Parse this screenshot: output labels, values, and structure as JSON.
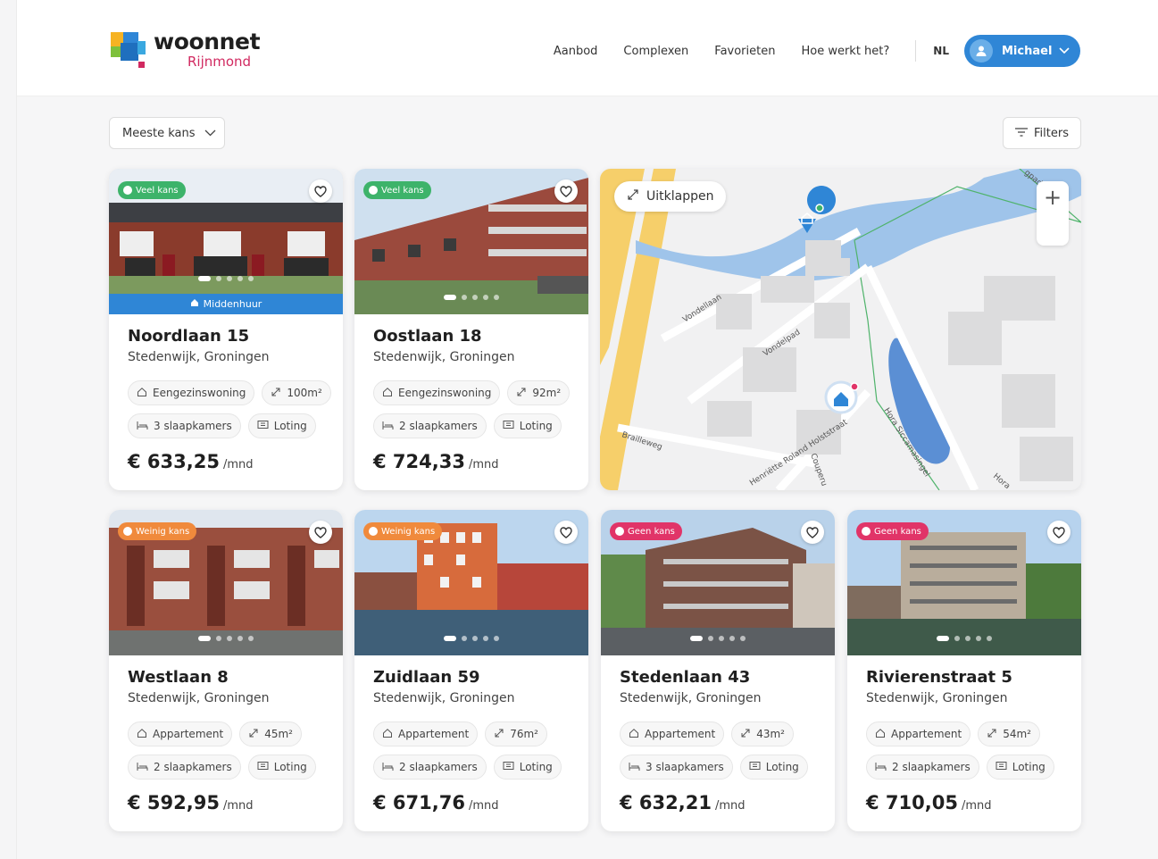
{
  "brand": {
    "name": "woonnet",
    "region": "Rijnmond"
  },
  "nav": {
    "items": [
      "Aanbod",
      "Complexen",
      "Favorieten",
      "Hoe werkt het?"
    ],
    "language": "NL",
    "user": "Michael"
  },
  "toolbar": {
    "sort_label": "Meeste kans",
    "filters_label": "Filters"
  },
  "map": {
    "expand_label": "Uitklappen",
    "streets": [
      "Vondellaan",
      "Vondelpad",
      "Brailleweg",
      "Hora Siccamasingel",
      "Henriëtte Roland Holststraat",
      "Couperu",
      "Hora",
      "gpad"
    ]
  },
  "colors": {
    "primary": "#2f86d6",
    "veel": "#3db36a",
    "weinig": "#f08a3c",
    "geen": "#e13468",
    "brand_pink": "#d12960"
  },
  "listings": [
    {
      "title": "Noordlaan 15",
      "location": "Stedenwijk, Groningen",
      "chance": "Veel kans",
      "chance_type": "veel",
      "ribbon": "Middenhuur",
      "type": "Eengezinswoning",
      "area": "100m²",
      "rooms": "3 slaapkamers",
      "method": "Loting",
      "price": "€ 633,25",
      "unit": "/mnd"
    },
    {
      "title": "Oostlaan 18",
      "location": "Stedenwijk, Groningen",
      "chance": "Veel kans",
      "chance_type": "veel",
      "type": "Eengezinswoning",
      "area": "92m²",
      "rooms": "2 slaapkamers",
      "method": "Loting",
      "price": "€ 724,33",
      "unit": "/mnd"
    },
    {
      "title": "Westlaan 8",
      "location": "Stedenwijk, Groningen",
      "chance": "Weinig kans",
      "chance_type": "weinig",
      "type": "Appartement",
      "area": "45m²",
      "rooms": "2 slaapkamers",
      "method": "Loting",
      "price": "€ 592,95",
      "unit": "/mnd"
    },
    {
      "title": "Zuidlaan 59",
      "location": "Stedenwijk, Groningen",
      "chance": "Weinig kans",
      "chance_type": "weinig",
      "type": "Appartement",
      "area": "76m²",
      "rooms": "2 slaapkamers",
      "method": "Loting",
      "price": "€ 671,76",
      "unit": "/mnd"
    },
    {
      "title": "Stedenlaan 43",
      "location": "Stedenwijk, Groningen",
      "chance": "Geen kans",
      "chance_type": "geen",
      "type": "Appartement",
      "area": "43m²",
      "rooms": "3 slaapkamers",
      "method": "Loting",
      "price": "€ 632,21",
      "unit": "/mnd"
    },
    {
      "title": "Rivierenstraat 5",
      "location": "Stedenwijk, Groningen",
      "chance": "Geen kans",
      "chance_type": "geen",
      "type": "Appartement",
      "area": "54m²",
      "rooms": "2 slaapkamers",
      "method": "Loting",
      "price": "€ 710,05",
      "unit": "/mnd"
    }
  ]
}
